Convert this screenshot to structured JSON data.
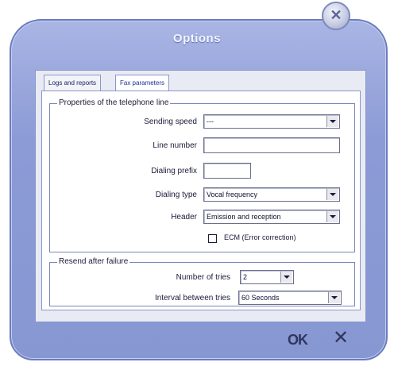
{
  "window": {
    "title": "Options"
  },
  "tabs": [
    {
      "label": "Logs and reports"
    },
    {
      "label": "Fax parameters"
    }
  ],
  "telephone_line": {
    "group_title": "Properties of the telephone line",
    "sending_speed": {
      "label": "Sending speed",
      "value": "---"
    },
    "line_number": {
      "label": "Line number",
      "value": ""
    },
    "dialing_prefix": {
      "label": "Dialing prefix",
      "value": ""
    },
    "dialing_type": {
      "label": "Dialing type",
      "value": "Vocal frequency"
    },
    "header": {
      "label": "Header",
      "value": "Emission and reception"
    },
    "ecm": {
      "label": "ECM (Error correction)",
      "checked": false
    }
  },
  "resend": {
    "group_title": "Resend after failure",
    "number_of_tries": {
      "label": "Number of tries",
      "value": "2"
    },
    "interval": {
      "label": "Interval between tries",
      "value": "60 Seconds"
    }
  },
  "buttons": {
    "ok": "OK",
    "cancel": "✕"
  }
}
